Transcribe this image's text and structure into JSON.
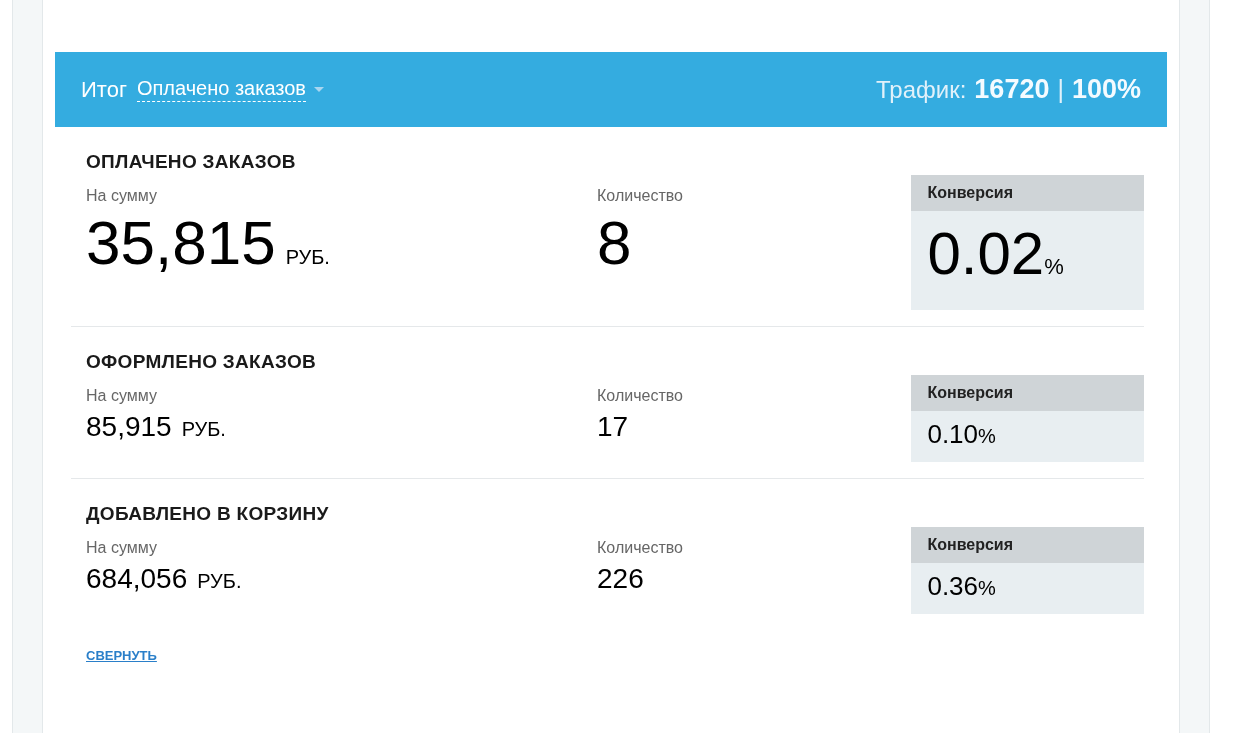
{
  "header": {
    "title": "Итог",
    "dropdown": "Оплачено заказов",
    "traffic_label": "Трафик:",
    "traffic_value": "16720",
    "separator": "|",
    "traffic_percent": "100%"
  },
  "sections": [
    {
      "kind": "large",
      "title": "ОПЛАЧЕНО ЗАКАЗОВ",
      "sum_label": "На сумму",
      "sum": "35,815",
      "currency": "РУБ.",
      "count_label": "Количество",
      "count": "8",
      "conversion_label": "Конверсия",
      "conversion": "0.02",
      "unit": "%"
    },
    {
      "kind": "small",
      "title": "ОФОРМЛЕНО ЗАКАЗОВ",
      "sum_label": "На сумму",
      "sum": "85,915",
      "currency": "РУБ.",
      "count_label": "Количество",
      "count": "17",
      "conversion_label": "Конверсия",
      "conversion": "0.10",
      "unit": "%"
    },
    {
      "kind": "small",
      "title": "ДОБАВЛЕНО В КОРЗИНУ",
      "sum_label": "На сумму",
      "sum": "684,056",
      "currency": "РУБ.",
      "count_label": "Количество",
      "count": "226",
      "conversion_label": "Конверсия",
      "conversion": "0.36",
      "unit": "%"
    }
  ],
  "collapse_link": "СВЕРНУТЬ"
}
